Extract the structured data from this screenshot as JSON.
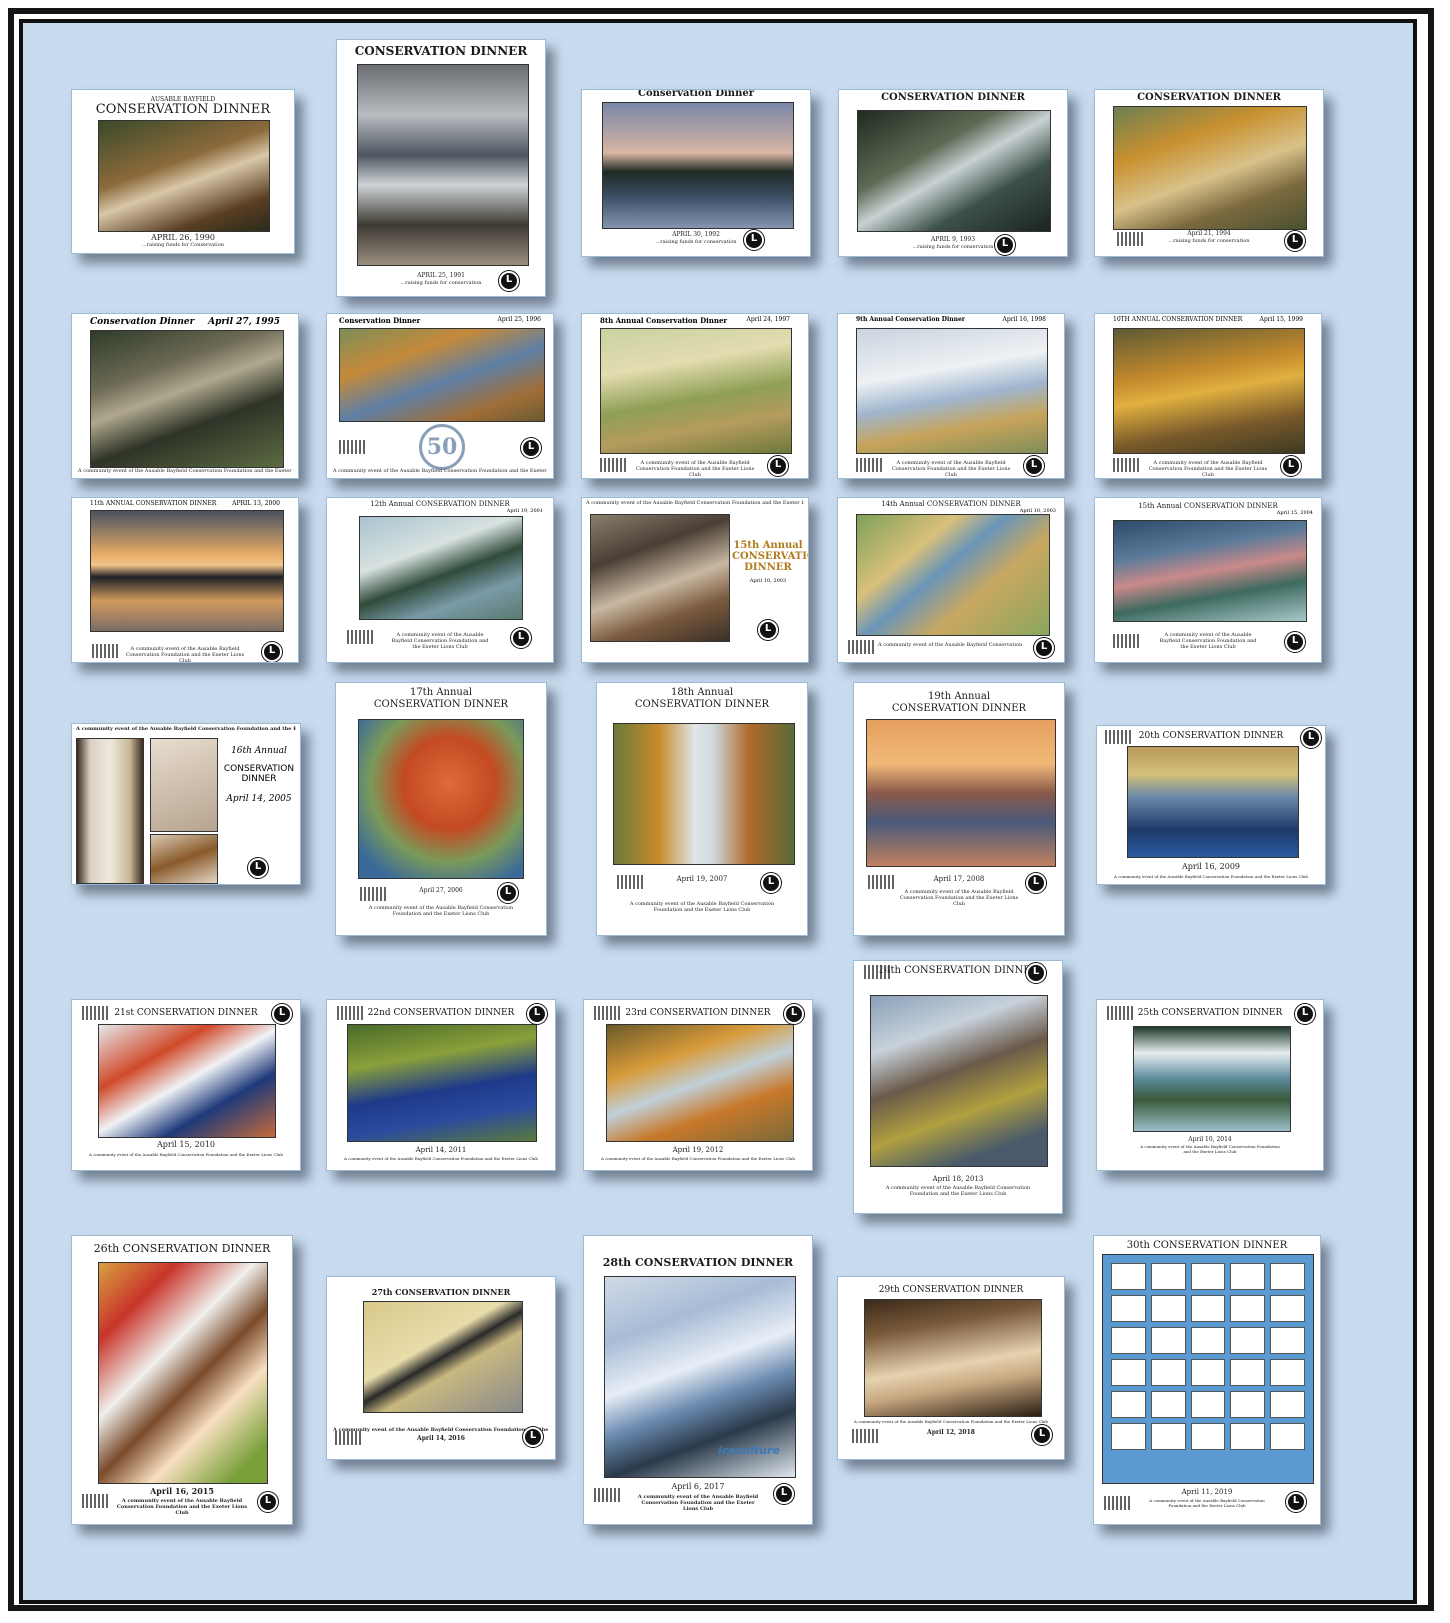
{
  "posters": {
    "p1": {
      "pre": "AUSABLE BAYFIELD",
      "title": "CONSERVATION DINNER",
      "date": "APRIL 26, 1990",
      "sub": "...raising funds for Conservation"
    },
    "p2": {
      "title": "CONSERVATION DINNER",
      "date": "APRIL 25, 1991",
      "sub": "...raising funds for conservation"
    },
    "p3": {
      "title": "Conservation Dinner",
      "date": "APRIL 30, 1992",
      "sub": "...raising funds for conservation"
    },
    "p4": {
      "title": "CONSERVATION DINNER",
      "date": "APRIL 9, 1993",
      "sub": "...raising funds for conservation"
    },
    "p5": {
      "title": "CONSERVATION DINNER",
      "date": "April 21, 1994",
      "sub": "...raising funds for conservation"
    },
    "p6": {
      "title": "Conservation Dinner",
      "date": "April 27, 1995"
    },
    "p7": {
      "title": "Conservation Dinner",
      "date": "April 25, 1996"
    },
    "p8": {
      "title": "8th Annual Conservation Dinner",
      "date": "April 24, 1997"
    },
    "p9": {
      "title": "9th Annual Conservation Dinner",
      "date": "April 16, 1998"
    },
    "p10": {
      "title": "10TH ANNUAL CONSERVATION DINNER",
      "date": "April 15, 1999"
    },
    "p11": {
      "title": "11th ANNUAL CONSERVATION DINNER",
      "date": "APRIL 13, 2000"
    },
    "p12": {
      "title": "12th Annual CONSERVATION DINNER",
      "date": "April 19, 2001"
    },
    "p13": {
      "top": "A community event of the Ausable Bayfield Conservation Foundation and the Exeter Lions Club",
      "title": "15th Annual CONSERVATION DINNER",
      "date": "April 10, 2003"
    },
    "p14": {
      "title": "14th Annual CONSERVATION DINNER",
      "date": "April 10, 2003"
    },
    "p15": {
      "title": "15th Annual CONSERVATION DINNER",
      "date": "April 15, 2004"
    },
    "p16": {
      "top": "A community event of the Ausable Bayfield Conservation Foundation and the Exeter Lions Club",
      "annual": "16th Annual",
      "title": "CONSERVATION DINNER",
      "date": "April 14, 2005"
    },
    "p17": {
      "annual": "17th Annual",
      "title": "CONSERVATION DINNER",
      "date": "April 27, 2006"
    },
    "p18": {
      "annual": "18th Annual",
      "title": "CONSERVATION DINNER",
      "date": "April 19, 2007"
    },
    "p19": {
      "annual": "19th Annual",
      "title": "CONSERVATION DINNER",
      "date": "April 17, 2008"
    },
    "p20": {
      "title": "20th CONSERVATION DINNER",
      "date": "April 16, 2009"
    },
    "p21": {
      "title": "21st CONSERVATION DINNER",
      "date": "April 15, 2010"
    },
    "p22": {
      "title": "22nd CONSERVATION DINNER",
      "date": "April 14, 2011"
    },
    "p23": {
      "title": "23rd CONSERVATION DINNER",
      "date": "April 19, 2012"
    },
    "p24": {
      "title": "24th CONSERVATION DINNER",
      "date": "April 18, 2013"
    },
    "p25": {
      "title": "25th CONSERVATION DINNER",
      "date": "April 10, 2014"
    },
    "p26": {
      "title": "26th CONSERVATION DINNER",
      "date": "April 16, 2015"
    },
    "p27": {
      "title": "27th CONSERVATION DINNER",
      "date": "April 14, 2016"
    },
    "p28": {
      "title": "28th CONSERVATION DINNER",
      "date": "April 6, 2017",
      "brand": "iceculture"
    },
    "p29": {
      "title": "29th CONSERVATION DINNER",
      "date": "April 12, 2018"
    },
    "p30": {
      "title": "30th CONSERVATION DINNER",
      "date": "April 11, 2019"
    }
  },
  "common": {
    "footer": "A community event of the Ausable Bayfield Conservation Foundation and the Exeter Lions Club"
  },
  "colors": {
    "background": "#c9dcef",
    "frame": "#151515",
    "accent_gold": "#b07a1c"
  }
}
